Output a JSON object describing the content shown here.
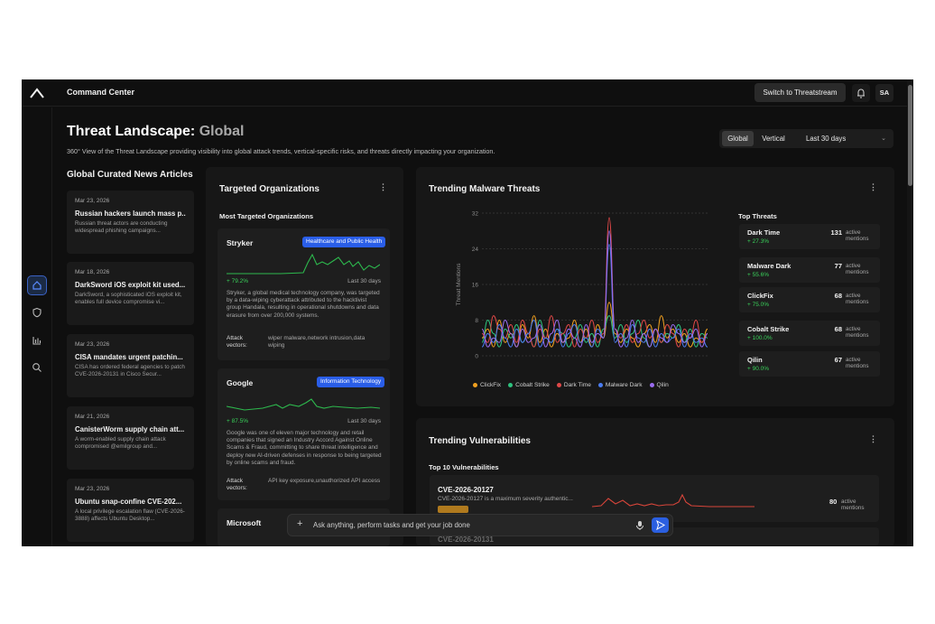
{
  "header": {
    "app_title": "Command Center",
    "switch_label": "Switch to Threatstream",
    "avatar": "SA"
  },
  "page": {
    "title": "Threat Landscape:",
    "title_accent": " Global",
    "subtitle": "360° View of the Threat Landscape providing visibility into global attack trends, vertical-specific risks, and threats directly impacting your organization."
  },
  "controls": {
    "segments": [
      "Global",
      "Vertical"
    ],
    "period": "Last 30 days"
  },
  "news": {
    "heading": "Global Curated News Articles",
    "items": [
      {
        "date": "Mar 23, 2026",
        "title": "Russian hackers launch mass p...",
        "snippet": "Russian threat actors are conducting widespread phishing campaigns..."
      },
      {
        "date": "Mar 18, 2026",
        "title": "DarkSword iOS exploit kit used...",
        "snippet": "DarkSword, a sophisticated iOS exploit kit, enables full device compromise vi..."
      },
      {
        "date": "Mar 23, 2026",
        "title": "CISA mandates urgent patchin...",
        "snippet": "CISA has ordered federal agencies to patch CVE-2026-20131 in Cisco Secur..."
      },
      {
        "date": "Mar 21, 2026",
        "title": "CanisterWorm supply chain att...",
        "snippet": "A worm-enabled supply chain attack compromised @emilgroup and..."
      },
      {
        "date": "Mar 23, 2026",
        "title": "Ubuntu snap-confine CVE-202...",
        "snippet": "A local privilege escalation flaw (CVE-2026-3888) affects Ubuntu Desktop..."
      }
    ]
  },
  "orgs": {
    "title": "Targeted Organizations",
    "subheading": "Most Targeted Organizations",
    "items": [
      {
        "name": "Stryker",
        "sector": "Healthcare and Public Health",
        "delta": "+ 79.2%",
        "period": "Last 30 days",
        "desc": "Stryker, a global medical technology company, was targeted by a data-wiping cyberattack attributed to the hacktivist group Handala, resulting in operational shutdowns and data erasure from over 200,000 systems.",
        "attack_label": "Attack vectors:",
        "vectors": "wiper malware,network intrusion,data wiping"
      },
      {
        "name": "Google",
        "sector": "Information Technology",
        "delta": "+ 87.5%",
        "period": "Last 30 days",
        "desc": "Google was one of eleven major technology and retail companies that signed an Industry Accord Against Online Scams & Fraud, committing to share threat intelligence and deploy new AI-driven defenses in response to being targeted by online scams and fraud.",
        "attack_label": "Attack vectors:",
        "vectors": "API key exposure,unauthorized API access"
      },
      {
        "name": "Microsoft"
      }
    ]
  },
  "malware": {
    "title": "Trending Malware Threats",
    "ylabel": "Threat Mentions",
    "top_heading": "Top Threats",
    "threats": [
      {
        "name": "Dark Time",
        "delta": "+ 27.3%",
        "count": "131",
        "label": "active mentions"
      },
      {
        "name": "Malware Dark",
        "delta": "+ 55.6%",
        "count": "77",
        "label": "active mentions"
      },
      {
        "name": "ClickFix",
        "delta": "+ 75.0%",
        "count": "68",
        "label": "active mentions"
      },
      {
        "name": "Cobalt Strike",
        "delta": "+ 100.0%",
        "count": "68",
        "label": "active mentions"
      },
      {
        "name": "Qilin",
        "delta": "+ 90.0%",
        "count": "67",
        "label": "active mentions"
      }
    ]
  },
  "chart_data": {
    "type": "line",
    "ylabel": "Threat Mentions",
    "ylim": [
      0,
      32
    ],
    "yticks": [
      0,
      8,
      16,
      24,
      32
    ],
    "legend": "bottom",
    "series": [
      {
        "name": "ClickFix",
        "color": "#f0a020",
        "values": [
          4,
          6,
          2,
          8,
          3,
          5,
          2,
          7,
          4,
          9,
          3,
          6,
          2,
          5,
          3,
          4,
          8,
          3,
          6,
          2,
          7,
          4,
          12,
          5,
          3,
          6,
          4,
          2,
          5,
          7,
          3,
          9,
          4,
          6,
          3,
          5,
          2,
          4,
          3,
          6
        ]
      },
      {
        "name": "Cobalt Strike",
        "color": "#2ec27e",
        "values": [
          3,
          8,
          5,
          2,
          6,
          4,
          7,
          3,
          5,
          2,
          8,
          4,
          3,
          6,
          5,
          2,
          4,
          7,
          3,
          5,
          2,
          6,
          9,
          4,
          7,
          3,
          5,
          8,
          4,
          2,
          6,
          3,
          5,
          4,
          7,
          3,
          6,
          2,
          5,
          4
        ]
      },
      {
        "name": "Dark Time",
        "color": "#e04848",
        "values": [
          5,
          3,
          9,
          6,
          4,
          7,
          3,
          8,
          5,
          2,
          6,
          4,
          9,
          3,
          5,
          7,
          2,
          6,
          4,
          8,
          3,
          5,
          31,
          6,
          4,
          7,
          3,
          5,
          8,
          4,
          6,
          3,
          7,
          5,
          2,
          6,
          4,
          8,
          3,
          5
        ]
      },
      {
        "name": "Malware Dark",
        "color": "#4a7cf0",
        "values": [
          2,
          5,
          3,
          7,
          4,
          2,
          6,
          3,
          5,
          8,
          2,
          4,
          3,
          6,
          2,
          5,
          7,
          3,
          4,
          2,
          6,
          4,
          25,
          3,
          5,
          2,
          7,
          4,
          3,
          6,
          2,
          5,
          3,
          4,
          6,
          2,
          5,
          3,
          4,
          2
        ]
      },
      {
        "name": "Qilin",
        "color": "#9a6cf0",
        "values": [
          6,
          2,
          4,
          3,
          8,
          5,
          2,
          6,
          3,
          4,
          7,
          2,
          5,
          8,
          3,
          6,
          4,
          2,
          7,
          3,
          5,
          4,
          28,
          6,
          2,
          4,
          8,
          3,
          5,
          2,
          6,
          4,
          3,
          7,
          5,
          3,
          4,
          6,
          2,
          5
        ]
      }
    ]
  },
  "vulns": {
    "title": "Trending Vulnerabilities",
    "subheading": "Top 10 Vulnerabilities",
    "items": [
      {
        "id": "CVE-2026-20127",
        "desc": "CVE-2026-20127 is a maximum severity authentic...",
        "count": "80",
        "label": "active mentions"
      },
      {
        "id": "CVE-2026-20131"
      }
    ]
  },
  "ask": {
    "placeholder": "Ask anything, perform tasks and get your job done"
  }
}
